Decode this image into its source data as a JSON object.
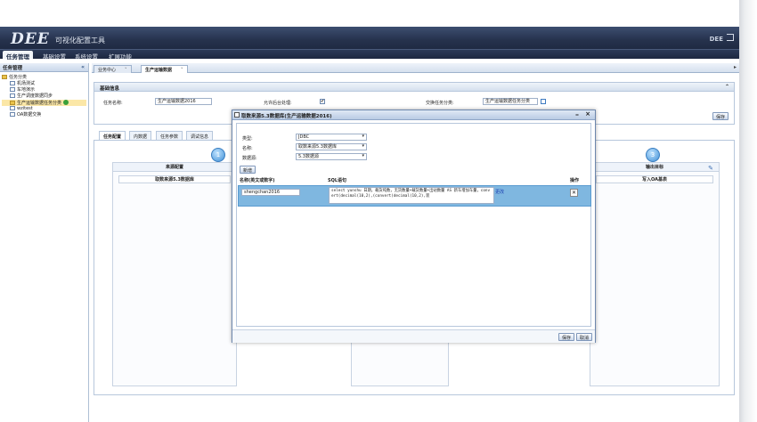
{
  "header": {
    "logo": "DEE",
    "app_title": "可视化配置工具",
    "right_label": "DEE"
  },
  "menubar": [
    "任务管理",
    "基础设置",
    "系统设置",
    "扩展功能"
  ],
  "left_panel": {
    "title": "任务管理",
    "collapse": "«",
    "tree": [
      {
        "label": "任务分类",
        "level": 0,
        "type": "folder"
      },
      {
        "label": "机场测试",
        "level": 1,
        "type": "file"
      },
      {
        "label": "车地演示",
        "level": 1,
        "type": "file"
      },
      {
        "label": "生产调度数据同步",
        "level": 1,
        "type": "file"
      },
      {
        "label": "生产运输数据任务分类",
        "level": 1,
        "type": "folder",
        "selected": true
      },
      {
        "label": "wzitest",
        "level": 1,
        "type": "file"
      },
      {
        "label": "OA数据交换",
        "level": 1,
        "type": "file"
      }
    ]
  },
  "top_tabs": [
    {
      "label": "业务中心",
      "active": false
    },
    {
      "label": "生产运输数据",
      "active": true
    }
  ],
  "basic": {
    "title": "基础信息",
    "task_name_label": "任务名称:",
    "task_name_value": "生产运输数据2016",
    "allow_bg_label": "允许后台处理:",
    "allow_bg_checked": "✔",
    "category_label": "交换任务分类:",
    "category_value": "生产运输数据任务分类",
    "save_label": "保存"
  },
  "sub_tabs": [
    "任务配置",
    "内数据",
    "任务参数",
    "调试信息"
  ],
  "panels": {
    "source_title": "来源配置",
    "source_item": "取数来源5.3数据库",
    "target_title": "输出目标",
    "target_item": "写入OA基表"
  },
  "modal": {
    "title": "取数来源5.3数据库(生产运输数据2016)",
    "type_label": "类型:",
    "type_value": "JDBC",
    "name_label": "名称:",
    "name_value": "取数来源5.3数据库",
    "datasource_label": "数据源:",
    "datasource_value": "5.3数据源",
    "add_label": "新增",
    "col_name": "名称(英文或数字)",
    "col_sql": "SQL语句",
    "col_op": "操作",
    "row_name": "shengchan2016",
    "row_sql": "select yunshu 日期，载货吨数，无货数量+载货数量+出站数量 AS 新车增加车量，convert(decimal(10,2),(convert(decimal(10,2),装",
    "row_link": "更改",
    "save_label": "保存",
    "cancel_label": "取消"
  }
}
